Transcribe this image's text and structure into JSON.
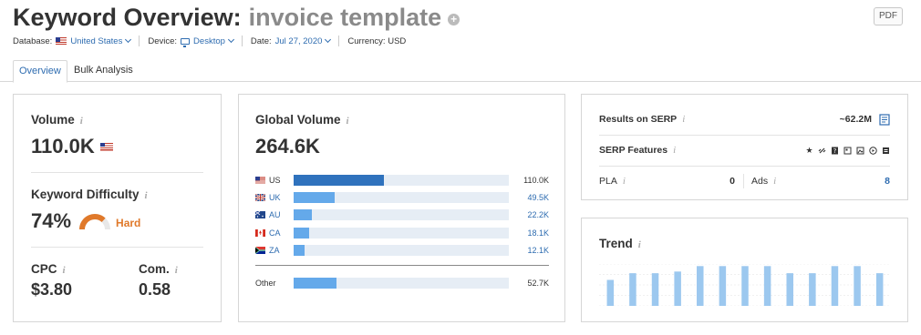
{
  "header": {
    "title": "Keyword Overview:",
    "keyword": "invoice template",
    "pdf_label": "PDF"
  },
  "meta": {
    "database_label": "Database:",
    "database_value": "United States",
    "device_label": "Device:",
    "device_value": "Desktop",
    "date_label": "Date:",
    "date_value": "Jul 27, 2020",
    "currency_label": "Currency:",
    "currency_value": "USD"
  },
  "tabs": [
    {
      "label": "Overview",
      "active": true
    },
    {
      "label": "Bulk Analysis",
      "active": false
    }
  ],
  "volume_card": {
    "volume_label": "Volume",
    "volume_value": "110.0K",
    "kd_label": "Keyword Difficulty",
    "kd_value": "74%",
    "kd_percent": 74,
    "kd_rating": "Hard",
    "cpc_label": "CPC",
    "cpc_value": "$3.80",
    "com_label": "Com.",
    "com_value": "0.58"
  },
  "global_volume": {
    "title": "Global Volume",
    "total": "264.6K",
    "countries": [
      {
        "code": "US",
        "value": "110.0K",
        "share": 0.42,
        "flag": "us"
      },
      {
        "code": "UK",
        "value": "49.5K",
        "share": 0.19,
        "flag": "uk"
      },
      {
        "code": "AU",
        "value": "22.2K",
        "share": 0.085,
        "flag": "au"
      },
      {
        "code": "CA",
        "value": "18.1K",
        "share": 0.07,
        "flag": "ca"
      },
      {
        "code": "ZA",
        "value": "12.1K",
        "share": 0.05,
        "flag": "za"
      }
    ],
    "other": {
      "code": "Other",
      "value": "52.7K",
      "share": 0.2
    }
  },
  "serp": {
    "results_label": "Results on SERP",
    "results_value": "~62.2M",
    "features_label": "SERP Features",
    "feature_icons": [
      "star-icon",
      "link-icon",
      "question-icon",
      "news-icon",
      "image-icon",
      "video-icon",
      "people-also-ask-icon"
    ],
    "pla_label": "PLA",
    "pla_value": "0",
    "ads_label": "Ads",
    "ads_value": "8"
  },
  "trend": {
    "title": "Trend",
    "values": [
      0.62,
      0.78,
      0.78,
      0.82,
      0.95,
      0.95,
      0.95,
      0.95,
      0.78,
      0.78,
      0.95,
      0.95,
      0.78
    ]
  },
  "colors": {
    "accent": "#2e6cb0",
    "bar_primary": "#2f72bd",
    "bar_secondary": "#64a9ea",
    "bar_track": "#e6edf5",
    "trend_bar": "#9cc8ef",
    "hard": "#e0792a"
  }
}
